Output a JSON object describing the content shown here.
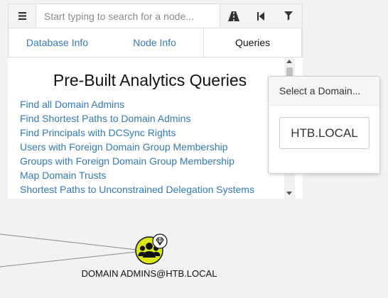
{
  "search": {
    "placeholder": "Start typing to search for a node..."
  },
  "toolbar": {
    "menu_icon": "hamburger-menu-icon",
    "path_icon": "road-icon",
    "back_icon": "step-backward-icon",
    "filter_icon": "filter-icon"
  },
  "tabs": [
    {
      "label": "Database Info",
      "active": false
    },
    {
      "label": "Node Info",
      "active": false
    },
    {
      "label": "Queries",
      "active": true
    }
  ],
  "queries": {
    "title": "Pre-Built Analytics Queries",
    "items": [
      "Find all Domain Admins",
      "Find Shortest Paths to Domain Admins",
      "Find Principals with DCSync Rights",
      "Users with Foreign Domain Group Membership",
      "Groups with Foreign Domain Group Membership",
      "Map Domain Trusts",
      "Shortest Paths to Unconstrained Delegation Systems"
    ]
  },
  "domain_select": {
    "header": "Select a Domain...",
    "options": [
      "HTB.LOCAL"
    ]
  },
  "graph": {
    "node_label": "DOMAIN ADMINS@HTB.LOCAL",
    "node_type": "group",
    "node_icon": "users-group-icon",
    "badge_icon": "gem-icon",
    "node_color": "#dbe617"
  },
  "colors": {
    "link": "#337ab7",
    "background": "#f2f2f2",
    "edge": "#7f8c8d"
  }
}
